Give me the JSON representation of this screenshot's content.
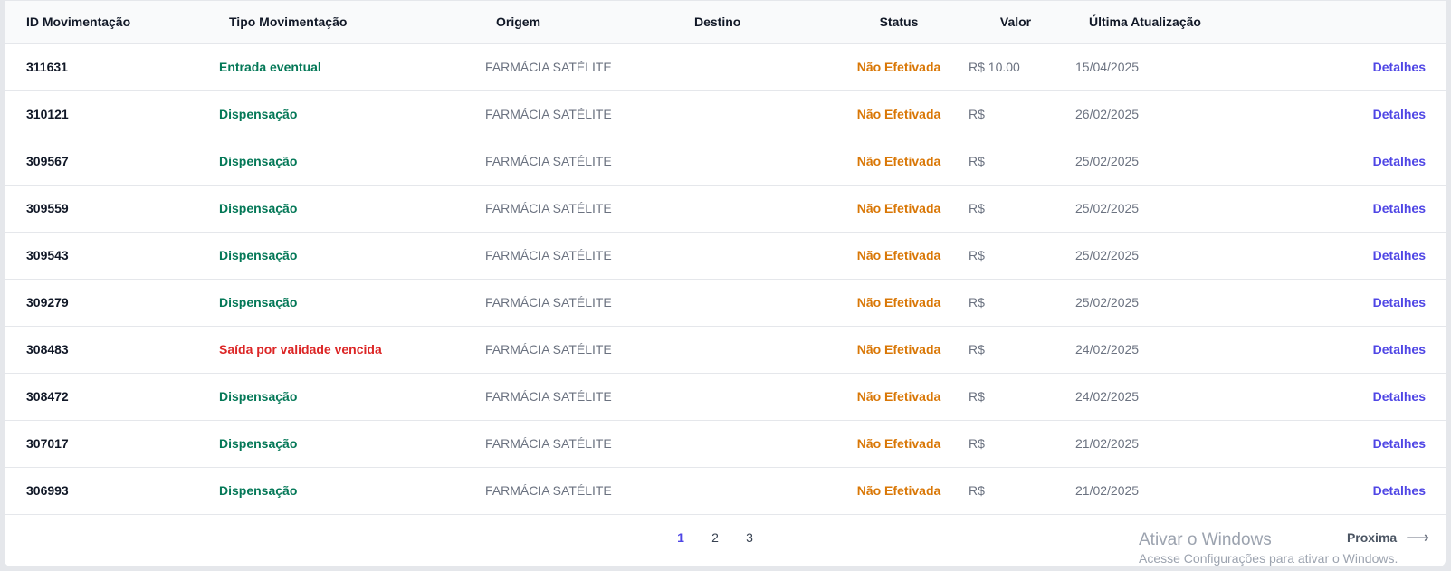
{
  "table": {
    "headers": {
      "id": "ID Movimentação",
      "tipo": "Tipo Movimentação",
      "origem": "Origem",
      "destino": "Destino",
      "status": "Status",
      "valor": "Valor",
      "atualizacao": "Última Atualização"
    },
    "rows": [
      {
        "id": "311631",
        "tipo": "Entrada eventual",
        "tipo_color": "green",
        "origem": "FARMÁCIA SATÉLITE",
        "destino": "",
        "status": "Não Efetivada",
        "valor": "R$ 10.00",
        "data": "15/04/2025",
        "acao": "Detalhes"
      },
      {
        "id": "310121",
        "tipo": "Dispensação",
        "tipo_color": "green",
        "origem": "FARMÁCIA SATÉLITE",
        "destino": "",
        "status": "Não Efetivada",
        "valor": "R$",
        "data": "26/02/2025",
        "acao": "Detalhes"
      },
      {
        "id": "309567",
        "tipo": "Dispensação",
        "tipo_color": "green",
        "origem": "FARMÁCIA SATÉLITE",
        "destino": "",
        "status": "Não Efetivada",
        "valor": "R$",
        "data": "25/02/2025",
        "acao": "Detalhes"
      },
      {
        "id": "309559",
        "tipo": "Dispensação",
        "tipo_color": "green",
        "origem": "FARMÁCIA SATÉLITE",
        "destino": "",
        "status": "Não Efetivada",
        "valor": "R$",
        "data": "25/02/2025",
        "acao": "Detalhes"
      },
      {
        "id": "309543",
        "tipo": "Dispensação",
        "tipo_color": "green",
        "origem": "FARMÁCIA SATÉLITE",
        "destino": "",
        "status": "Não Efetivada",
        "valor": "R$",
        "data": "25/02/2025",
        "acao": "Detalhes"
      },
      {
        "id": "309279",
        "tipo": "Dispensação",
        "tipo_color": "green",
        "origem": "FARMÁCIA SATÉLITE",
        "destino": "",
        "status": "Não Efetivada",
        "valor": "R$",
        "data": "25/02/2025",
        "acao": "Detalhes"
      },
      {
        "id": "308483",
        "tipo": "Saída por validade vencida",
        "tipo_color": "red",
        "origem": "FARMÁCIA SATÉLITE",
        "destino": "",
        "status": "Não Efetivada",
        "valor": "R$",
        "data": "24/02/2025",
        "acao": "Detalhes"
      },
      {
        "id": "308472",
        "tipo": "Dispensação",
        "tipo_color": "green",
        "origem": "FARMÁCIA SATÉLITE",
        "destino": "",
        "status": "Não Efetivada",
        "valor": "R$",
        "data": "24/02/2025",
        "acao": "Detalhes"
      },
      {
        "id": "307017",
        "tipo": "Dispensação",
        "tipo_color": "green",
        "origem": "FARMÁCIA SATÉLITE",
        "destino": "",
        "status": "Não Efetivada",
        "valor": "R$",
        "data": "21/02/2025",
        "acao": "Detalhes"
      },
      {
        "id": "306993",
        "tipo": "Dispensação",
        "tipo_color": "green",
        "origem": "FARMÁCIA SATÉLITE",
        "destino": "",
        "status": "Não Efetivada",
        "valor": "R$",
        "data": "21/02/2025",
        "acao": "Detalhes"
      }
    ]
  },
  "pagination": {
    "pages": [
      "1",
      "2",
      "3"
    ],
    "current": "1",
    "next_label": "Proxima",
    "next_icon": "arrow-right-icon"
  },
  "watermark": {
    "title": "Ativar o Windows",
    "subtitle": "Acesse Configurações para ativar o Windows."
  },
  "colors": {
    "green": "#047857",
    "red": "#dc2626",
    "status": "#d97706",
    "link": "#4f46e5"
  }
}
